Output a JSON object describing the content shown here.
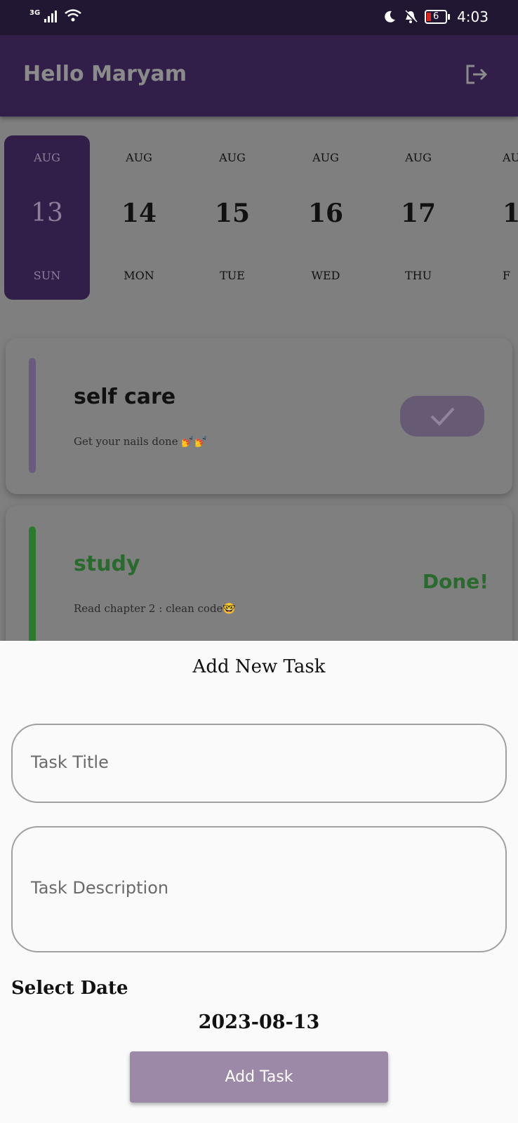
{
  "status_bar": {
    "network": "3G",
    "time": "4:03",
    "battery_level": "6"
  },
  "app_bar": {
    "greeting": "Hello Maryam",
    "logout_icon": "logout-icon"
  },
  "dates": [
    {
      "month": "AUG",
      "day": "13",
      "weekday": "SUN",
      "selected": true
    },
    {
      "month": "AUG",
      "day": "14",
      "weekday": "MON"
    },
    {
      "month": "AUG",
      "day": "15",
      "weekday": "TUE"
    },
    {
      "month": "AUG",
      "day": "16",
      "weekday": "WED"
    },
    {
      "month": "AUG",
      "day": "17",
      "weekday": "THU"
    },
    {
      "month": "AU",
      "day": "1",
      "weekday": "F"
    }
  ],
  "tasks": [
    {
      "title": "self care",
      "description": "Get your nails done 💅💅",
      "status": "pending",
      "accent": "#6a5a80"
    },
    {
      "title": "study",
      "description": "Read chapter 2 : clean code🤓",
      "status_text": "Done!",
      "accent": "#2b7a2f"
    }
  ],
  "sheet": {
    "title": "Add New Task",
    "task_title_placeholder": "Task Title",
    "task_description_placeholder": "Task Description",
    "select_date_label": "Select Date",
    "date_value": "2023-08-13",
    "add_button": "Add Task"
  },
  "colors": {
    "primary": "#311f49",
    "button": "#9c89a8",
    "done": "#2b6a2e"
  }
}
